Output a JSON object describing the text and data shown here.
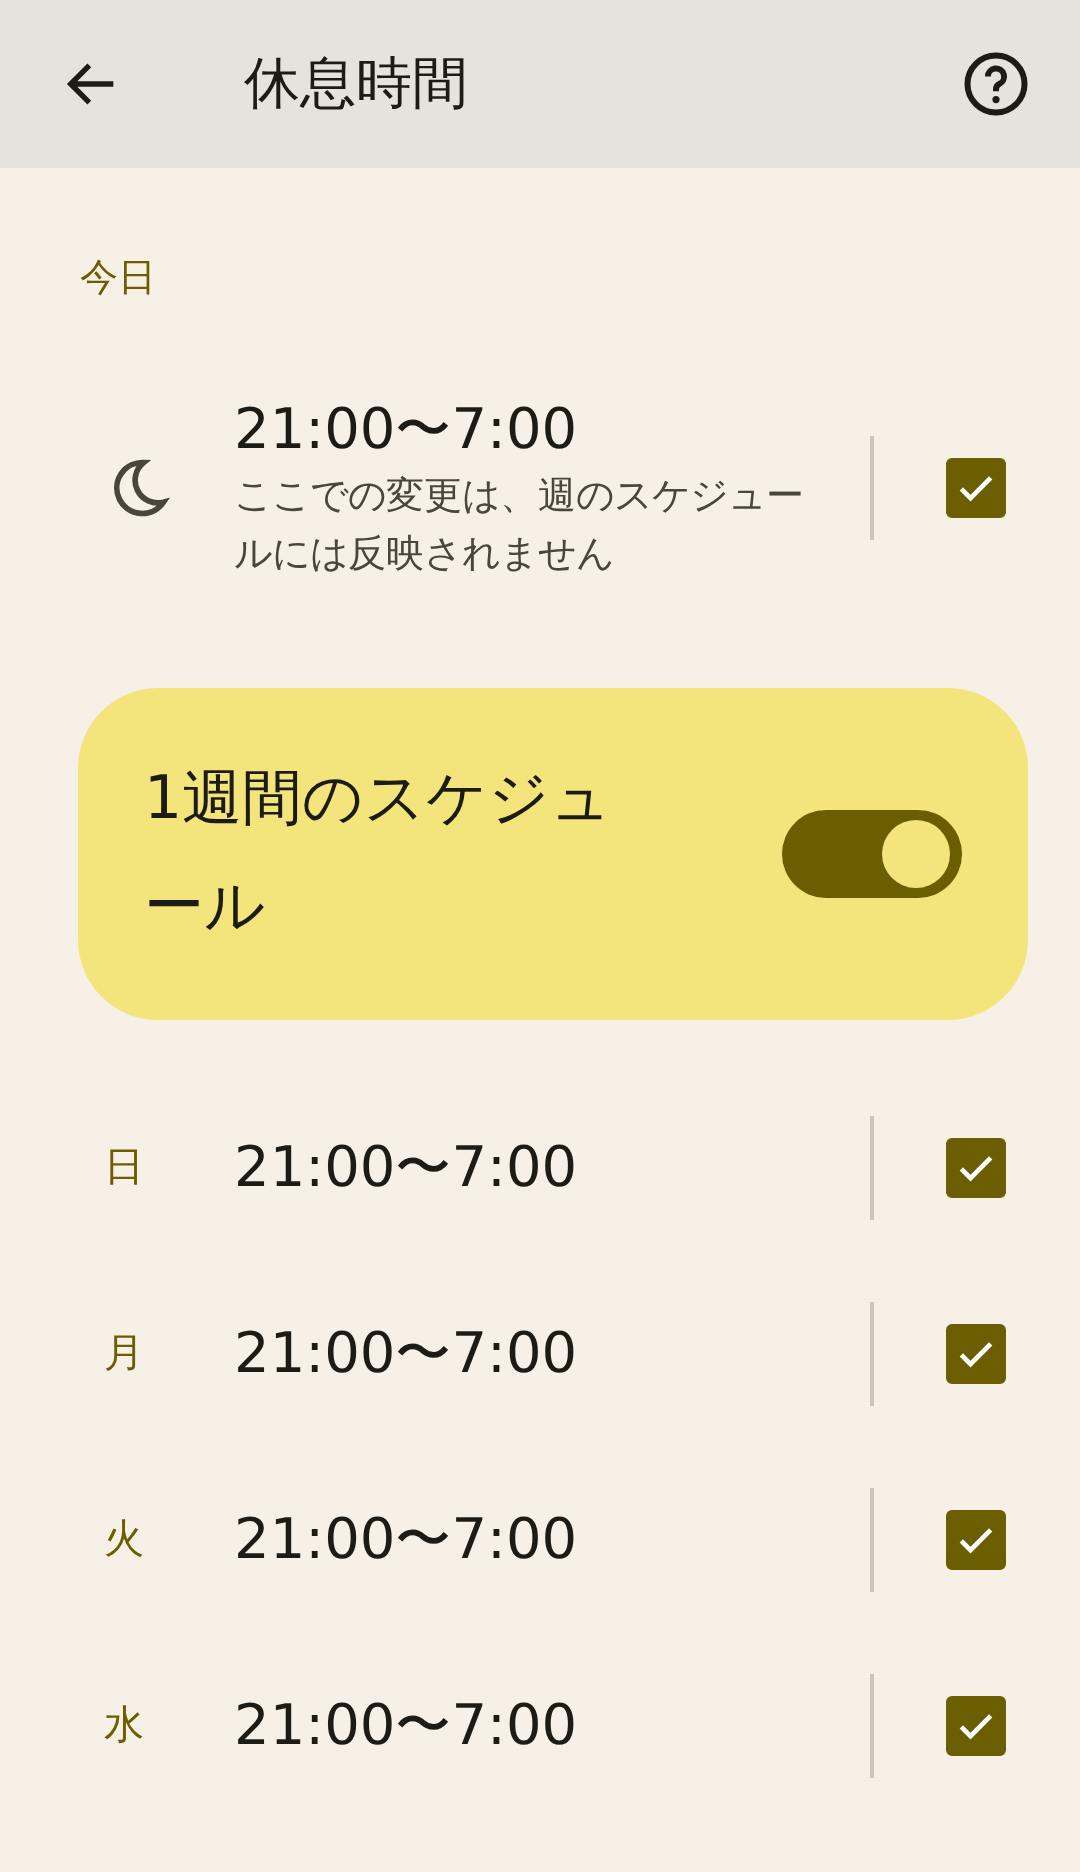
{
  "header": {
    "title": "休息時間"
  },
  "today": {
    "label": "今日",
    "time": "21:00〜7:00",
    "note": "ここでの変更は、週のスケジュールには反映されません",
    "checked": true
  },
  "weekly": {
    "label": "1週間のスケジュール",
    "on": true
  },
  "days": [
    {
      "day": "日",
      "time": "21:00〜7:00",
      "checked": true
    },
    {
      "day": "月",
      "time": "21:00〜7:00",
      "checked": true
    },
    {
      "day": "火",
      "time": "21:00〜7:00",
      "checked": true
    },
    {
      "day": "水",
      "time": "21:00〜7:00",
      "checked": true
    }
  ]
}
